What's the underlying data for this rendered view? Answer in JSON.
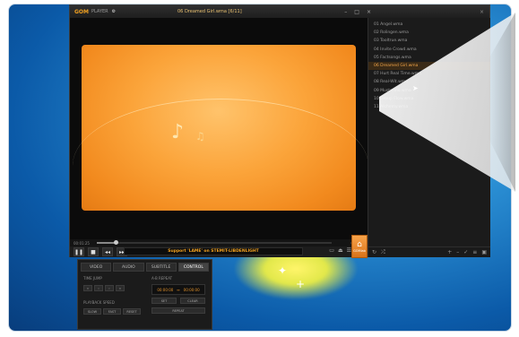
{
  "app": {
    "logo": "GOM",
    "logo_sub": "PLAYER",
    "window_title": "06 Dreamed Girl.wma  [6/11]",
    "window_buttons": [
      "minimize-icon",
      "maximize-icon",
      "close-icon"
    ]
  },
  "seek": {
    "elapsed": "00:01:25",
    "progress": 0.08,
    "icons": [
      "repeat-icon",
      "volume-icon",
      "settings-icon"
    ]
  },
  "controls": {
    "ticker_text": "Support 'LAME' on STEMIT-LIBDENLIGHT",
    "buttons": [
      "pause-icon",
      "stop-icon",
      "prev-icon",
      "next-icon"
    ],
    "right_buttons": [
      "screen-icon",
      "eject-icon",
      "menu-icon"
    ],
    "home_label": "GOMlab"
  },
  "playlist": {
    "items": [
      "01 Angel.wma",
      "02 Rolingen.wma",
      "03 Tooltrue.wma",
      "04 Invite Crowd.wma",
      "05 Factsongs.wma",
      "06 Dreamed Girl.wma",
      "07 Hurt Real Time.wma",
      "08 Real-Wit.wma",
      "09 Mustarino.wma",
      "10 Group Flow.wma",
      "11 Alchemy.wma"
    ],
    "active_index": 5,
    "footer_left": [
      "repeat-icon",
      "shuffle-icon"
    ],
    "footer_right": [
      "add-icon",
      "remove-icon",
      "check-icon",
      "list-icon",
      "save-icon"
    ]
  },
  "panel": {
    "tabs": [
      "VIDEO",
      "AUDIO",
      "SUBTITLE",
      "CONTROL"
    ],
    "active_tab": "CONTROL",
    "time_jump_label": "TIME JUMP",
    "time_jump_buttons": [
      "«",
      "‹",
      "›",
      "»"
    ],
    "ab_repeat_label": "A-B REPEAT",
    "ab_start": "00:00:00",
    "ab_arrow": "↔",
    "ab_end": "00:00:00",
    "ab_buttons": [
      "SET",
      "CLEAR"
    ],
    "ab_wide_button": "REPEAT",
    "speed_label": "PLAYBACK SPEED",
    "speed_buttons": [
      "SLOW",
      "FAST",
      "RESET"
    ]
  }
}
